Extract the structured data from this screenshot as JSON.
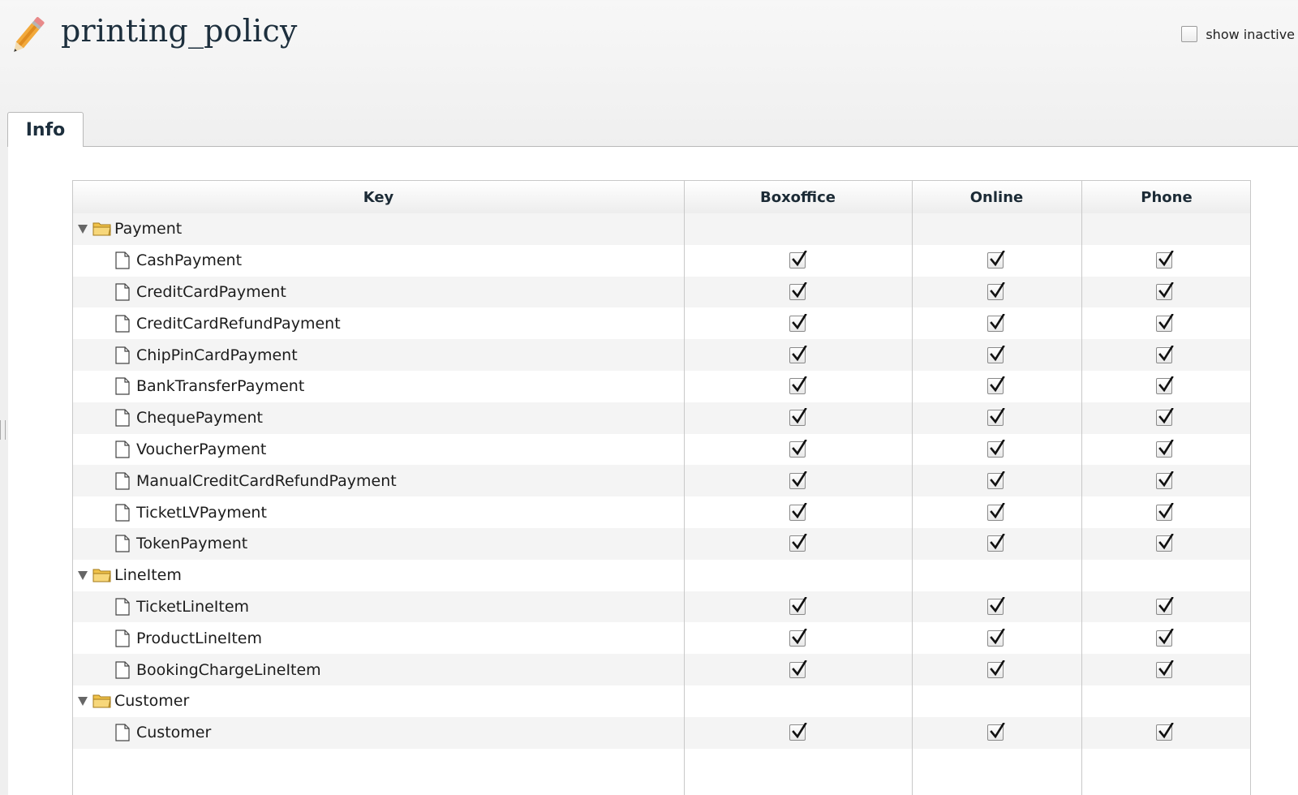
{
  "header": {
    "title": "printing_policy",
    "show_inactive_label": "show inactive"
  },
  "tabs": [
    {
      "label": "Info"
    }
  ],
  "table": {
    "columns": [
      "Key",
      "Boxoffice",
      "Online",
      "Phone"
    ],
    "groups": [
      {
        "name": "Payment",
        "expanded": true,
        "items": [
          {
            "name": "CashPayment",
            "boxoffice": true,
            "online": true,
            "phone": true
          },
          {
            "name": "CreditCardPayment",
            "boxoffice": true,
            "online": true,
            "phone": true
          },
          {
            "name": "CreditCardRefundPayment",
            "boxoffice": true,
            "online": true,
            "phone": true
          },
          {
            "name": "ChipPinCardPayment",
            "boxoffice": true,
            "online": true,
            "phone": true
          },
          {
            "name": "BankTransferPayment",
            "boxoffice": true,
            "online": true,
            "phone": true
          },
          {
            "name": "ChequePayment",
            "boxoffice": true,
            "online": true,
            "phone": true
          },
          {
            "name": "VoucherPayment",
            "boxoffice": true,
            "online": true,
            "phone": true
          },
          {
            "name": "ManualCreditCardRefundPayment",
            "boxoffice": true,
            "online": true,
            "phone": true
          },
          {
            "name": "TicketLVPayment",
            "boxoffice": true,
            "online": true,
            "phone": true
          },
          {
            "name": "TokenPayment",
            "boxoffice": true,
            "online": true,
            "phone": true
          }
        ]
      },
      {
        "name": "LineItem",
        "expanded": true,
        "items": [
          {
            "name": "TicketLineItem",
            "boxoffice": true,
            "online": true,
            "phone": true
          },
          {
            "name": "ProductLineItem",
            "boxoffice": true,
            "online": true,
            "phone": true
          },
          {
            "name": "BookingChargeLineItem",
            "boxoffice": true,
            "online": true,
            "phone": true
          }
        ]
      },
      {
        "name": "Customer",
        "expanded": true,
        "items": [
          {
            "name": "Customer",
            "boxoffice": true,
            "online": true,
            "phone": true
          }
        ]
      }
    ]
  },
  "colors": {
    "folder": "#f0c24a",
    "title": "#1d2f3d",
    "row_alt": "#f4f4f4"
  }
}
